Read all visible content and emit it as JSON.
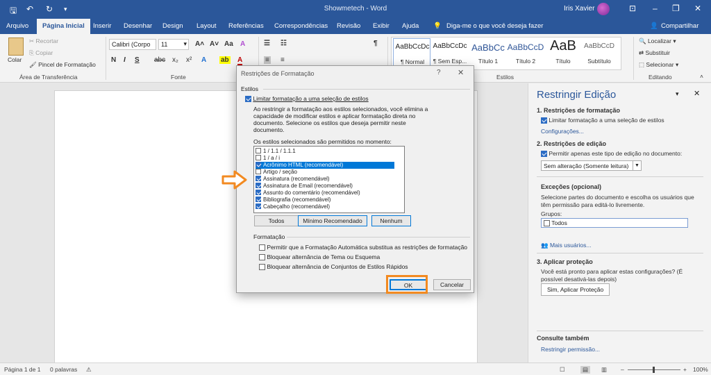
{
  "window": {
    "title": "Showmetech - Word",
    "user": "Iris Xavier",
    "share_label": "Compartilhar"
  },
  "menu": {
    "tabs": [
      "Arquivo",
      "Página Inicial",
      "Inserir",
      "Desenhar",
      "Design",
      "Layout",
      "Referências",
      "Correspondências",
      "Revisão",
      "Exibir",
      "Ajuda"
    ],
    "tellme": "Diga-me o que você deseja fazer"
  },
  "ribbon": {
    "clipboard": {
      "paste": "Colar",
      "cut": "Recortar",
      "copy": "Copiar",
      "format_painter": "Pincel de Formatação",
      "group": "Área de Transferência"
    },
    "font": {
      "name": "Calibri (Corpo",
      "size": "11",
      "group": "Fonte"
    },
    "styles": {
      "group": "Estilos",
      "items": [
        {
          "preview": "AaBbCcDc",
          "name": "¶ Normal"
        },
        {
          "preview": "AaBbCcDc",
          "name": "¶ Sem Esp..."
        },
        {
          "preview": "AaBbCc",
          "name": "Título 1"
        },
        {
          "preview": "AaBbCcD",
          "name": "Título 2"
        },
        {
          "preview": "AaB",
          "name": "Título"
        },
        {
          "preview": "AaBbCcD",
          "name": "Subtítulo"
        }
      ]
    },
    "editing": {
      "find": "Localizar",
      "replace": "Substituir",
      "select": "Selecionar",
      "group": "Editando"
    }
  },
  "pane": {
    "title": "Restringir Edição",
    "sec1": "1. Restrições de formatação",
    "sec1_check": "Limitar formatação a uma seleção de estilos",
    "sec1_link": "Configurações...",
    "sec2": "2. Restrições de edição",
    "sec2_check": "Permitir apenas este tipo de edição no documento:",
    "sec2_select": "Sem alteração (Somente leitura)",
    "exceptions_title": "Exceções (opcional)",
    "exceptions_text1": "Selecione partes do documento e escolha os usuários que",
    "exceptions_text2": "têm permissão para editá-lo livremente.",
    "groups_label": "Grupos:",
    "groups_item": "Todos",
    "more_users": "Mais usuários...",
    "sec3": "3. Aplicar proteção",
    "sec3_text1": "Você está pronto para aplicar estas configurações? (É",
    "sec3_text2": "possível desativá-las depois)",
    "apply_button": "Sim, Aplicar Proteção",
    "see_also": "Consulte também",
    "restrict_perm": "Restringir permissão..."
  },
  "status": {
    "page": "Página 1 de 1",
    "words": "0 palavras",
    "zoom": "100%"
  },
  "dialog": {
    "title": "Restrições de Formatação",
    "help": "?",
    "styles_header": "Estilos",
    "limit_check": "Limitar formatação a uma seleção de estilos",
    "desc1": "Ao restringir a formatação aos estilos selecionados, você elimina a",
    "desc2": "capacidade de modificar estilos e aplicar formatação direta no",
    "desc3": "documento. Selecione os estilos que deseja  permitir neste",
    "desc4": "documento.",
    "list_label": "Os estilos selecionados são permitidos no momento:",
    "list_items": [
      {
        "label": "1 / 1.1 / 1.1.1",
        "checked": false,
        "selected": false
      },
      {
        "label": "1 / a / i",
        "checked": false,
        "selected": false
      },
      {
        "label": "Acrônimo HTML (recomendável)",
        "checked": true,
        "selected": true
      },
      {
        "label": "Artigo / seção",
        "checked": false,
        "selected": false
      },
      {
        "label": "Assinatura (recomendável)",
        "checked": true,
        "selected": false
      },
      {
        "label": "Assinatura de Email (recomendável)",
        "checked": true,
        "selected": false
      },
      {
        "label": "Assunto do comentário (recomendável)",
        "checked": true,
        "selected": false
      },
      {
        "label": "Bibliografia (recomendável)",
        "checked": true,
        "selected": false
      },
      {
        "label": "Cabeçalho (recomendável)",
        "checked": true,
        "selected": false
      }
    ],
    "btn_all": "Todos",
    "btn_min": "Mínimo Recomendado",
    "btn_none": "Nenhum",
    "formatting_header": "Formatação",
    "fmt1": "Permitir que a Formatação Automática substitua as restrições de formatação",
    "fmt2": "Bloquear alternância de Tema ou Esquema",
    "fmt3": "Bloquear alternância de Conjuntos de Estilos Rápidos",
    "ok": "OK",
    "cancel": "Cancelar"
  },
  "colors": {
    "accent": "#2b579a",
    "highlight": "#f28a21",
    "selection": "#0078d7"
  }
}
